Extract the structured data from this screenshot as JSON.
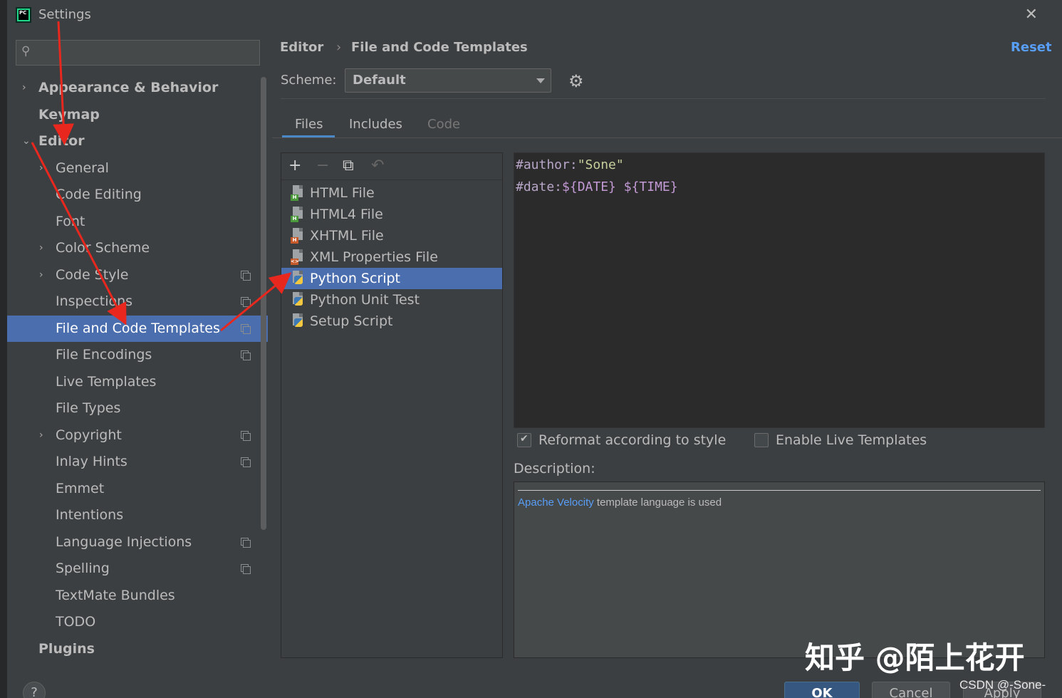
{
  "window": {
    "title": "Settings",
    "app_logo_text": "PC"
  },
  "search": {
    "placeholder": "",
    "icon": "search-icon"
  },
  "sidebar": {
    "items": [
      {
        "label": "Appearance & Behavior",
        "level": 0,
        "chevron": "›"
      },
      {
        "label": "Keymap",
        "level": 0
      },
      {
        "label": "Editor",
        "level": 0,
        "chevron": "⌄"
      },
      {
        "label": "General",
        "level": 1,
        "chevron": "›"
      },
      {
        "label": "Code Editing",
        "level": 1
      },
      {
        "label": "Font",
        "level": 1
      },
      {
        "label": "Color Scheme",
        "level": 1,
        "chevron": "›"
      },
      {
        "label": "Code Style",
        "level": 1,
        "chevron": "›",
        "copy": true
      },
      {
        "label": "Inspections",
        "level": 1,
        "copy": true
      },
      {
        "label": "File and Code Templates",
        "level": 1,
        "copy": true,
        "selected": true
      },
      {
        "label": "File Encodings",
        "level": 1,
        "copy": true
      },
      {
        "label": "Live Templates",
        "level": 1
      },
      {
        "label": "File Types",
        "level": 1
      },
      {
        "label": "Copyright",
        "level": 1,
        "chevron": "›",
        "copy": true
      },
      {
        "label": "Inlay Hints",
        "level": 1,
        "copy": true
      },
      {
        "label": "Emmet",
        "level": 1
      },
      {
        "label": "Intentions",
        "level": 1
      },
      {
        "label": "Language Injections",
        "level": 1,
        "copy": true
      },
      {
        "label": "Spelling",
        "level": 1,
        "copy": true
      },
      {
        "label": "TextMate Bundles",
        "level": 1
      },
      {
        "label": "TODO",
        "level": 1
      },
      {
        "label": "Plugins",
        "level": 0
      }
    ]
  },
  "header": {
    "breadcrumb_1": "Editor",
    "breadcrumb_sep": "›",
    "breadcrumb_2": "File and Code Templates",
    "reset": "Reset"
  },
  "scheme": {
    "label": "Scheme:",
    "value": "Default"
  },
  "tabs": [
    {
      "label": "Files",
      "active": true
    },
    {
      "label": "Includes"
    },
    {
      "label": "Code",
      "disabled": true
    }
  ],
  "list_toolbar": {
    "add": "+",
    "remove": "−",
    "copy": "⧉",
    "reset": "↶"
  },
  "templates": [
    {
      "label": "HTML File",
      "icon": "html-file-icon",
      "tag": "H"
    },
    {
      "label": "HTML4 File",
      "icon": "html-file-icon",
      "tag": "H"
    },
    {
      "label": "XHTML File",
      "icon": "xhtml-file-icon",
      "tag": "H"
    },
    {
      "label": "XML Properties File",
      "icon": "xml-file-icon",
      "tag": "<>"
    },
    {
      "label": "Python Script",
      "icon": "python-file-icon",
      "selected": true
    },
    {
      "label": "Python Unit Test",
      "icon": "python-file-icon"
    },
    {
      "label": "Setup Script",
      "icon": "python-file-icon"
    }
  ],
  "editor": {
    "line1": {
      "directive": "#author:",
      "string": "\"Sone\""
    },
    "line2": {
      "directive": "#date:",
      "var1": "${DATE}",
      "space": " ",
      "var2": "${TIME}"
    }
  },
  "options": {
    "reformat": {
      "label": "Reformat according to style",
      "checked": true
    },
    "live_templates": {
      "label": "Enable Live Templates",
      "checked": false
    }
  },
  "description": {
    "label": "Description:",
    "link": "Apache Velocity",
    "text": " template language is used"
  },
  "buttons": {
    "help": "?",
    "ok": "OK",
    "cancel": "Cancel",
    "apply": "Apply"
  },
  "watermarks": {
    "zhihu": "知乎 @陌上花开",
    "csdn": "CSDN @-Sone-"
  },
  "colors": {
    "accent": "#4b6eaf",
    "link": "#589df6",
    "annotation": "#e8281e"
  }
}
